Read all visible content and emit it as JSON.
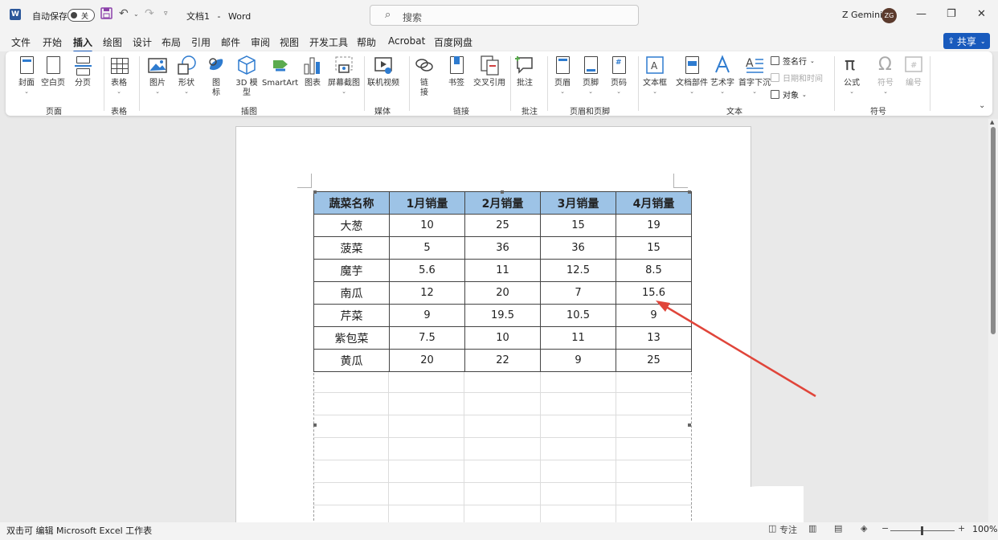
{
  "titlebar": {
    "autosave_label": "自动保存",
    "autosave_state": "关",
    "doc_name": "文档1",
    "app_separator": "-",
    "app_name": "Word",
    "search_placeholder": "搜索",
    "user_name": "Z Gemini",
    "user_initials": "ZG",
    "word_logo": "W"
  },
  "menu": {
    "tabs": [
      "文件",
      "开始",
      "插入",
      "绘图",
      "设计",
      "布局",
      "引用",
      "邮件",
      "审阅",
      "视图",
      "开发工具",
      "帮助",
      "Acrobat",
      "百度网盘"
    ],
    "active_tab": "插入",
    "share_label": "共享"
  },
  "ribbon": {
    "pages_group": {
      "label": "页面",
      "items": [
        "封面",
        "空白页",
        "分页"
      ]
    },
    "tables_group": {
      "label": "表格",
      "items": [
        "表格"
      ]
    },
    "illustrations_group": {
      "label": "插图",
      "items": [
        "图片",
        "形状",
        "图标",
        "3D 模型",
        "SmartArt",
        "图表",
        "屏幕截图"
      ]
    },
    "media_group": {
      "label": "媒体",
      "items": [
        "联机视频"
      ]
    },
    "links_group": {
      "label": "链接",
      "items": [
        "链接",
        "书签",
        "交叉引用"
      ]
    },
    "comments_group": {
      "label": "批注",
      "items": [
        "批注"
      ]
    },
    "header_footer_group": {
      "label": "页眉和页脚",
      "items": [
        "页眉",
        "页脚",
        "页码"
      ]
    },
    "text_group": {
      "label": "文本",
      "items": [
        "文本框",
        "文档部件",
        "艺术字",
        "首字下沉"
      ],
      "small_items": [
        "签名行",
        "日期和时间",
        "对象"
      ]
    },
    "symbols_group": {
      "label": "符号",
      "items": [
        "公式",
        "符号",
        "编号"
      ]
    }
  },
  "table": {
    "headers": [
      "蔬菜名称",
      "1月销量",
      "2月销量",
      "3月销量",
      "4月销量"
    ],
    "rows": [
      [
        "大葱",
        "10",
        "25",
        "15",
        "19"
      ],
      [
        "菠菜",
        "5",
        "36",
        "36",
        "15"
      ],
      [
        "魔芋",
        "5.6",
        "11",
        "12.5",
        "8.5"
      ],
      [
        "南瓜",
        "12",
        "20",
        "7",
        "15.6"
      ],
      [
        "芹菜",
        "9",
        "19.5",
        "10.5",
        "9"
      ],
      [
        "紫包菜",
        "7.5",
        "10",
        "11",
        "13"
      ],
      [
        "黄瓜",
        "20",
        "22",
        "9",
        "25"
      ]
    ],
    "header_color": "#9dc3e6"
  },
  "annotation": {
    "arrow_color": "#e0453a",
    "points_to": "15.6"
  },
  "statusbar": {
    "message": "双击可 编辑 Microsoft Excel 工作表",
    "focus_label": "专注",
    "zoom": "100%"
  },
  "colors": {
    "accent": "#185abd",
    "word_blue": "#2b579a"
  }
}
